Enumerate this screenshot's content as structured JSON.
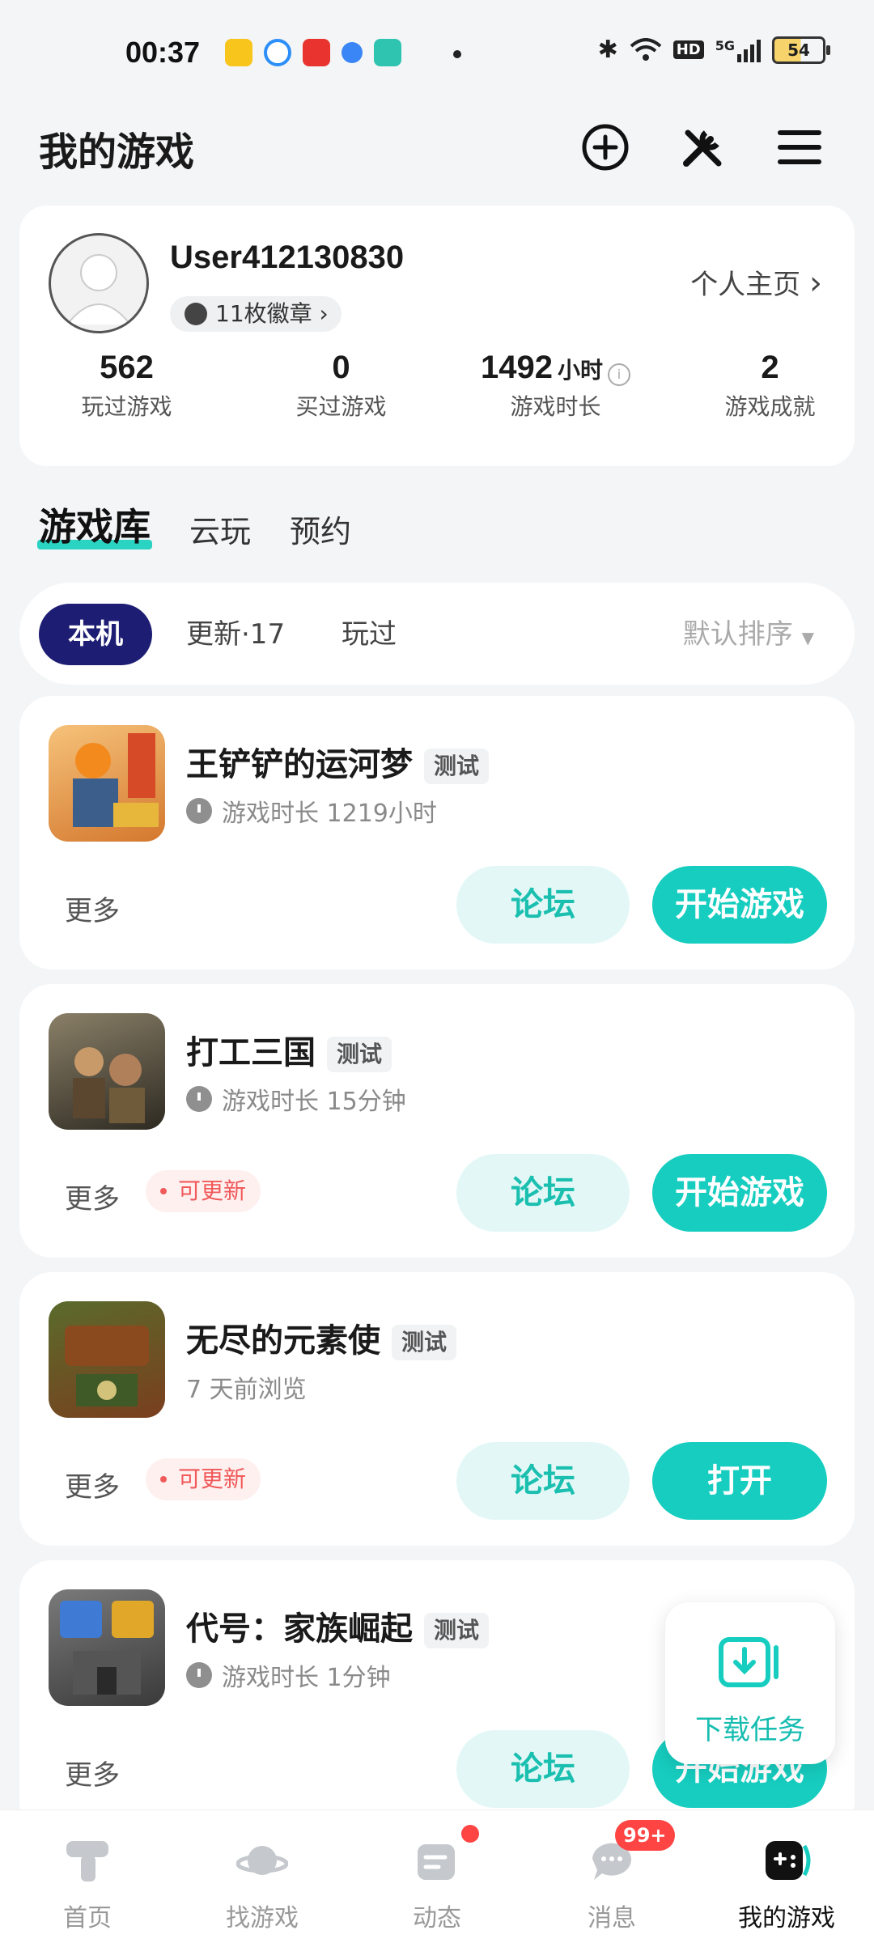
{
  "status_bar": {
    "time": "00:37",
    "battery": "54",
    "network": "5G",
    "hd": "HD"
  },
  "header": {
    "title": "我的游戏"
  },
  "profile": {
    "username": "User412130830",
    "badges": "11枚徽章",
    "homepage_link": "个人主页",
    "stats": [
      {
        "value": "562",
        "unit": "",
        "label": "玩过游戏"
      },
      {
        "value": "0",
        "unit": "",
        "label": "买过游戏"
      },
      {
        "value": "1492",
        "unit": "小时",
        "label": "游戏时长"
      },
      {
        "value": "2",
        "unit": "",
        "label": "游戏成就"
      }
    ]
  },
  "tabs": [
    "游戏库",
    "云玩",
    "预约"
  ],
  "filters": {
    "chips": [
      "本机",
      "更新·17",
      "玩过"
    ],
    "sort": "默认排序"
  },
  "games": [
    {
      "name": "王铲铲的运河梦",
      "tag": "测试",
      "sub": "游戏时长 1219小时",
      "more": "更多",
      "update": "",
      "forum": "论坛",
      "action": "开始游戏",
      "icon_colors": [
        "#f2a650",
        "#c75a2a"
      ]
    },
    {
      "name": "打工三国",
      "tag": "测试",
      "sub": "游戏时长 15分钟",
      "more": "更多",
      "update": "可更新",
      "forum": "论坛",
      "action": "开始游戏",
      "icon_colors": [
        "#6d6552",
        "#2f2a22"
      ]
    },
    {
      "name": "无尽的元素使",
      "tag": "测试",
      "sub": "7 天前浏览",
      "more": "更多",
      "update": "可更新",
      "forum": "论坛",
      "action": "打开",
      "icon_colors": [
        "#4a5a2a",
        "#7a3e1e"
      ]
    },
    {
      "name": "代号：家族崛起",
      "tag": "测试",
      "sub": "游戏时长 1分钟",
      "more": "更多",
      "update": "",
      "forum": "论坛",
      "action": "开始游戏",
      "icon_colors": [
        "#6a6a6a",
        "#3e3e3e"
      ]
    }
  ],
  "download_float": {
    "label": "下载任务"
  },
  "bottom_nav": [
    {
      "label": "首页",
      "icon": "home-icon"
    },
    {
      "label": "找游戏",
      "icon": "planet-icon"
    },
    {
      "label": "动态",
      "icon": "feed-icon"
    },
    {
      "label": "消息",
      "icon": "chat-icon",
      "badge": "99+"
    },
    {
      "label": "我的游戏",
      "icon": "gamepad-icon"
    }
  ],
  "accent_color": "#16cdbf",
  "chip_active_color": "#1d1d73"
}
